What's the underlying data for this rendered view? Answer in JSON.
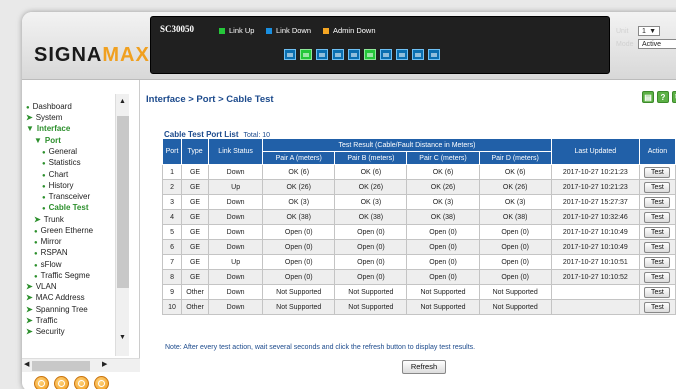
{
  "brand": {
    "logo_main": "SIGNA",
    "logo_accent": "MAX",
    "accent_color": "#f0a020"
  },
  "device": {
    "model": "SC30050",
    "legend": [
      {
        "label": "Link Up",
        "color": "#25c73a"
      },
      {
        "label": "Link Down",
        "color": "#1a8fe0"
      },
      {
        "label": "Admin Down",
        "color": "#f5a623"
      }
    ],
    "ports": [
      "down",
      "up",
      "down",
      "down",
      "down",
      "up",
      "down",
      "down",
      "down",
      "down"
    ],
    "unit_label": "Unit",
    "unit_value": "1",
    "mode_label": "Mode",
    "mode_value": "Active"
  },
  "sidebar": {
    "items": [
      {
        "label": "Dashboard",
        "kind": "leaf1"
      },
      {
        "label": "System",
        "kind": "folder"
      },
      {
        "label": "Interface",
        "kind": "open"
      },
      {
        "label": "Port",
        "kind": "open-sub"
      },
      {
        "label": "General",
        "kind": "leaf2"
      },
      {
        "label": "Statistics",
        "kind": "leaf2"
      },
      {
        "label": "Chart",
        "kind": "leaf2"
      },
      {
        "label": "History",
        "kind": "leaf2"
      },
      {
        "label": "Transceiver",
        "kind": "leaf2"
      },
      {
        "label": "Cable Test",
        "kind": "leaf2-active"
      },
      {
        "label": "Trunk",
        "kind": "folder-sub"
      },
      {
        "label": "Green Etherne",
        "kind": "leaf1-sub"
      },
      {
        "label": "Mirror",
        "kind": "leaf1-sub"
      },
      {
        "label": "RSPAN",
        "kind": "leaf1-sub"
      },
      {
        "label": "sFlow",
        "kind": "leaf1-sub"
      },
      {
        "label": "Traffic Segme",
        "kind": "leaf1-sub"
      },
      {
        "label": "VLAN",
        "kind": "folder"
      },
      {
        "label": "MAC Address",
        "kind": "folder"
      },
      {
        "label": "Spanning Tree",
        "kind": "folder"
      },
      {
        "label": "Traffic",
        "kind": "folder"
      },
      {
        "label": "Security",
        "kind": "folder"
      }
    ]
  },
  "main": {
    "breadcrumb": "Interface > Port > Cable Test",
    "list_title": "Cable Test Port List",
    "total": "Total: 10",
    "columns": {
      "port": "Port",
      "type": "Type",
      "link_status": "Link Status",
      "result_group": "Test Result (Cable/Fault Distance in Meters)",
      "pair_a": "Pair A (meters)",
      "pair_b": "Pair B (meters)",
      "pair_c": "Pair C (meters)",
      "pair_d": "Pair D (meters)",
      "last_updated": "Last Updated",
      "action": "Action"
    },
    "rows": [
      {
        "port": "1",
        "type": "GE",
        "status": "Down",
        "a": "OK (6)",
        "b": "OK (6)",
        "c": "OK (6)",
        "d": "OK (6)",
        "updated": "2017-10-27 10:21:23",
        "action": "Test"
      },
      {
        "port": "2",
        "type": "GE",
        "status": "Up",
        "a": "OK (26)",
        "b": "OK (26)",
        "c": "OK (26)",
        "d": "OK (26)",
        "updated": "2017-10-27 10:21:23",
        "action": "Test"
      },
      {
        "port": "3",
        "type": "GE",
        "status": "Down",
        "a": "OK (3)",
        "b": "OK (3)",
        "c": "OK (3)",
        "d": "OK (3)",
        "updated": "2017-10-27 15:27:37",
        "action": "Test"
      },
      {
        "port": "4",
        "type": "GE",
        "status": "Down",
        "a": "OK (38)",
        "b": "OK (38)",
        "c": "OK (38)",
        "d": "OK (38)",
        "updated": "2017-10-27 10:32:46",
        "action": "Test"
      },
      {
        "port": "5",
        "type": "GE",
        "status": "Down",
        "a": "Open (0)",
        "b": "Open (0)",
        "c": "Open (0)",
        "d": "Open (0)",
        "updated": "2017-10-27 10:10:49",
        "action": "Test"
      },
      {
        "port": "6",
        "type": "GE",
        "status": "Down",
        "a": "Open (0)",
        "b": "Open (0)",
        "c": "Open (0)",
        "d": "Open (0)",
        "updated": "2017-10-27 10:10:49",
        "action": "Test"
      },
      {
        "port": "7",
        "type": "GE",
        "status": "Up",
        "a": "Open (0)",
        "b": "Open (0)",
        "c": "Open (0)",
        "d": "Open (0)",
        "updated": "2017-10-27 10:10:51",
        "action": "Test"
      },
      {
        "port": "8",
        "type": "GE",
        "status": "Down",
        "a": "Open (0)",
        "b": "Open (0)",
        "c": "Open (0)",
        "d": "Open (0)",
        "updated": "2017-10-27 10:10:52",
        "action": "Test"
      },
      {
        "port": "9",
        "type": "Other",
        "status": "Down",
        "a": "Not Supported",
        "b": "Not Supported",
        "c": "Not Supported",
        "d": "Not Supported",
        "updated": "",
        "action": "Test"
      },
      {
        "port": "10",
        "type": "Other",
        "status": "Down",
        "a": "Not Supported",
        "b": "Not Supported",
        "c": "Not Supported",
        "d": "Not Supported",
        "updated": "",
        "action": "Test"
      }
    ],
    "note": "Note: After every test action, wait several seconds and click the refresh button to display test results.",
    "refresh_label": "Refresh"
  }
}
